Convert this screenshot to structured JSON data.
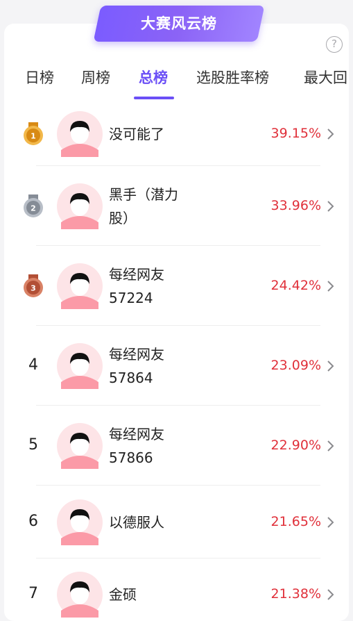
{
  "banner": {
    "title": "大赛风云榜"
  },
  "help_icon": "?",
  "tabs": [
    {
      "label": "日榜",
      "active": false
    },
    {
      "label": "周榜",
      "active": false
    },
    {
      "label": "总榜",
      "active": true
    },
    {
      "label": "选股胜率榜",
      "active": false
    },
    {
      "label": "最大回",
      "active": false
    }
  ],
  "rankings": [
    {
      "rank": "1",
      "medal": "gold-medal-icon",
      "name_line1": "没可能了",
      "name_line2": "",
      "rate": "39.15%"
    },
    {
      "rank": "2",
      "medal": "silver-medal-icon",
      "name_line1": "黑手（潜力",
      "name_line2": "股）",
      "rate": "33.96%"
    },
    {
      "rank": "3",
      "medal": "bronze-medal-icon",
      "name_line1": "每经网友",
      "name_line2": "57224",
      "rate": "24.42%"
    },
    {
      "rank": "4",
      "medal": "",
      "name_line1": "每经网友",
      "name_line2": "57864",
      "rate": "23.09%"
    },
    {
      "rank": "5",
      "medal": "",
      "name_line1": "每经网友",
      "name_line2": "57866",
      "rate": "22.90%"
    },
    {
      "rank": "6",
      "medal": "",
      "name_line1": "以德服人",
      "name_line2": "",
      "rate": "21.65%"
    },
    {
      "rank": "7",
      "medal": "",
      "name_line1": "金硕",
      "name_line2": "",
      "rate": "21.38%"
    }
  ],
  "colors": {
    "accent": "#6b4ff6",
    "rate": "#e0303a",
    "gold": "#e8a623",
    "silver": "#9aa1ab",
    "bronze": "#c9674a"
  }
}
